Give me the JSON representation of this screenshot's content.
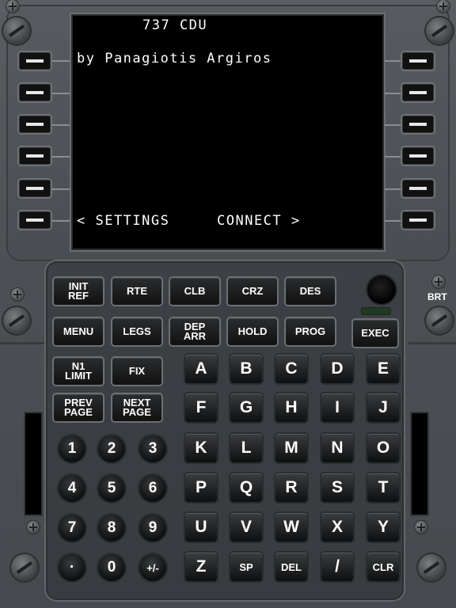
{
  "screen": {
    "title": "737 CDU",
    "line1": "by Panagiotis Argiros",
    "left_prompt": "< SETTINGS",
    "right_prompt": "CONNECT >"
  },
  "line_select_keys": {
    "left": [
      "LSK 1L",
      "LSK 2L",
      "LSK 3L",
      "LSK 4L",
      "LSK 5L",
      "LSK 6L"
    ],
    "right": [
      "LSK 1R",
      "LSK 2R",
      "LSK 3R",
      "LSK 4R",
      "LSK 5R",
      "LSK 6R"
    ]
  },
  "function_keys": {
    "row1": [
      "INIT\nREF",
      "RTE",
      "CLB",
      "CRZ",
      "DES"
    ],
    "row2": [
      "MENU",
      "LEGS",
      "DEP\nARR",
      "HOLD",
      "PROG"
    ],
    "n1_limit": "N1\nLIMIT",
    "fix": "FIX",
    "prev_page": "PREV\nPAGE",
    "next_page": "NEXT\nPAGE",
    "exec": "EXEC"
  },
  "brt_label": "BRT",
  "alpha_keys": [
    [
      "A",
      "B",
      "C",
      "D",
      "E"
    ],
    [
      "F",
      "G",
      "H",
      "I",
      "J"
    ],
    [
      "K",
      "L",
      "M",
      "N",
      "O"
    ],
    [
      "P",
      "Q",
      "R",
      "S",
      "T"
    ],
    [
      "U",
      "V",
      "W",
      "X",
      "Y"
    ],
    [
      "Z",
      "SP",
      "DEL",
      "/",
      "CLR"
    ]
  ],
  "numeric_keys": [
    [
      "1",
      "2",
      "3"
    ],
    [
      "4",
      "5",
      "6"
    ],
    [
      "7",
      "8",
      "9"
    ],
    [
      "·",
      "0",
      "+/-"
    ]
  ],
  "colors": {
    "screen_bg": "#000000",
    "screen_text": "#ffffff",
    "panel": "#4d5155",
    "exec_light_off": "#1f3a22"
  }
}
